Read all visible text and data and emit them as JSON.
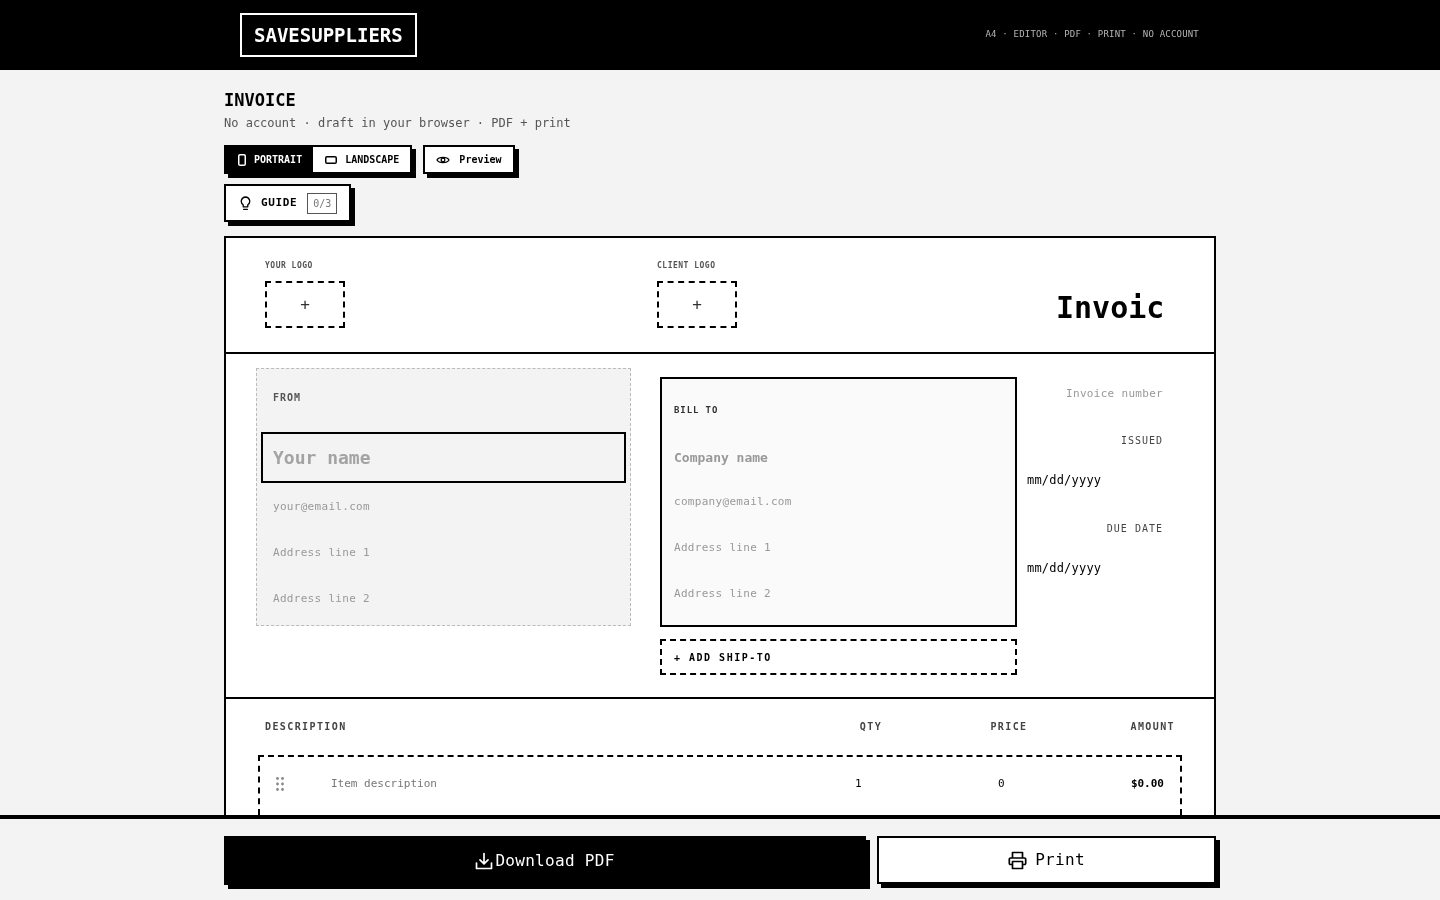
{
  "header": {
    "logo": "SAVESUPPLIERS",
    "tagline": "A4 · EDITOR · PDF · PRINT · NO ACCOUNT"
  },
  "page": {
    "title": "INVOICE",
    "subtitle": "No account · draft in your browser · PDF + print"
  },
  "orientation_tabs": [
    {
      "kind": "portrait",
      "label": "PORTRAIT",
      "selected": true
    },
    {
      "kind": "landscape",
      "label": "LANDSCAPE",
      "selected": false
    }
  ],
  "preview_button": {
    "label": "Preview"
  },
  "guide_button": {
    "label": "GUIDE",
    "progress": "0/3"
  },
  "invoice": {
    "logos": [
      {
        "label": "YOUR LOGO",
        "button": "+"
      },
      {
        "label": "CLIENT LOGO",
        "button": "+"
      }
    ],
    "title": "Invoic",
    "from": {
      "label": "FROM",
      "fields": [
        {
          "kind": "name",
          "placeholder": "Your name",
          "focused": true
        },
        {
          "kind": "email",
          "placeholder": "your@email.com",
          "focused": false
        },
        {
          "kind": "address",
          "placeholder": "Address line 1",
          "focused": false
        },
        {
          "kind": "address",
          "placeholder": "Address line 2",
          "focused": false
        }
      ]
    },
    "bill_to": {
      "label": "BILL TO",
      "fields": [
        {
          "kind": "name",
          "placeholder": "Company name",
          "focused": false
        },
        {
          "kind": "email",
          "placeholder": "company@email.com",
          "focused": false
        },
        {
          "kind": "address",
          "placeholder": "Address line 1",
          "focused": false
        },
        {
          "kind": "address",
          "placeholder": "Address line 2",
          "focused": false
        }
      ]
    },
    "add_ship_to": "+ ADD SHIP-TO",
    "invoice_number": {
      "placeholder": "Invoice number"
    },
    "dates": [
      {
        "label": "ISSUED",
        "placeholder": "mm/dd/yyyy"
      },
      {
        "label": "DUE DATE",
        "placeholder": "mm/dd/yyyy"
      }
    ],
    "items": {
      "columns": [
        "DESCRIPTION",
        "QTY",
        "PRICE",
        "AMOUNT"
      ],
      "rows": [
        {
          "description": {
            "placeholder": "Item description"
          },
          "qty": "1",
          "price": "0",
          "amount": "$0.00"
        }
      ]
    }
  },
  "actions": [
    {
      "kind": "download",
      "label": "Download PDF"
    },
    {
      "kind": "print",
      "label": "Print"
    }
  ]
}
